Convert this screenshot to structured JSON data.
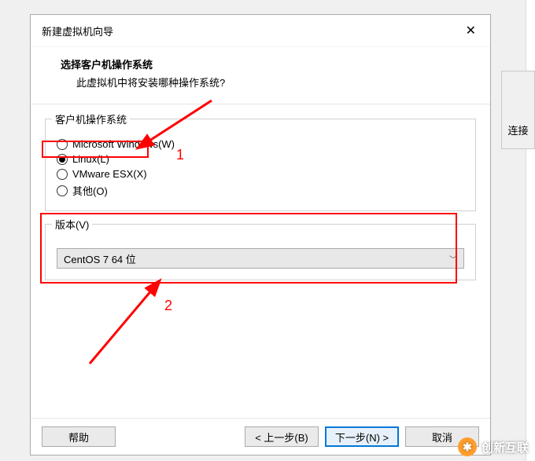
{
  "side_panel_label": "连接",
  "dialog": {
    "title": "新建虚拟机向导",
    "header_title": "选择客户机操作系统",
    "header_sub": "此虚拟机中将安装哪种操作系统?"
  },
  "os_group": {
    "legend": "客户机操作系统",
    "options": [
      {
        "label": "Microsoft Windows(W)",
        "selected": false
      },
      {
        "label": "Linux(L)",
        "selected": true
      },
      {
        "label": "VMware ESX(X)",
        "selected": false
      },
      {
        "label": "其他(O)",
        "selected": false
      }
    ]
  },
  "version_group": {
    "legend": "版本(V)",
    "selected": "CentOS 7 64 位"
  },
  "buttons": {
    "help": "帮助",
    "back": "< 上一步(B)",
    "next": "下一步(N) >",
    "cancel": "取消"
  },
  "annotations": {
    "num1": "1",
    "num2": "2"
  },
  "watermark": "创新互联"
}
